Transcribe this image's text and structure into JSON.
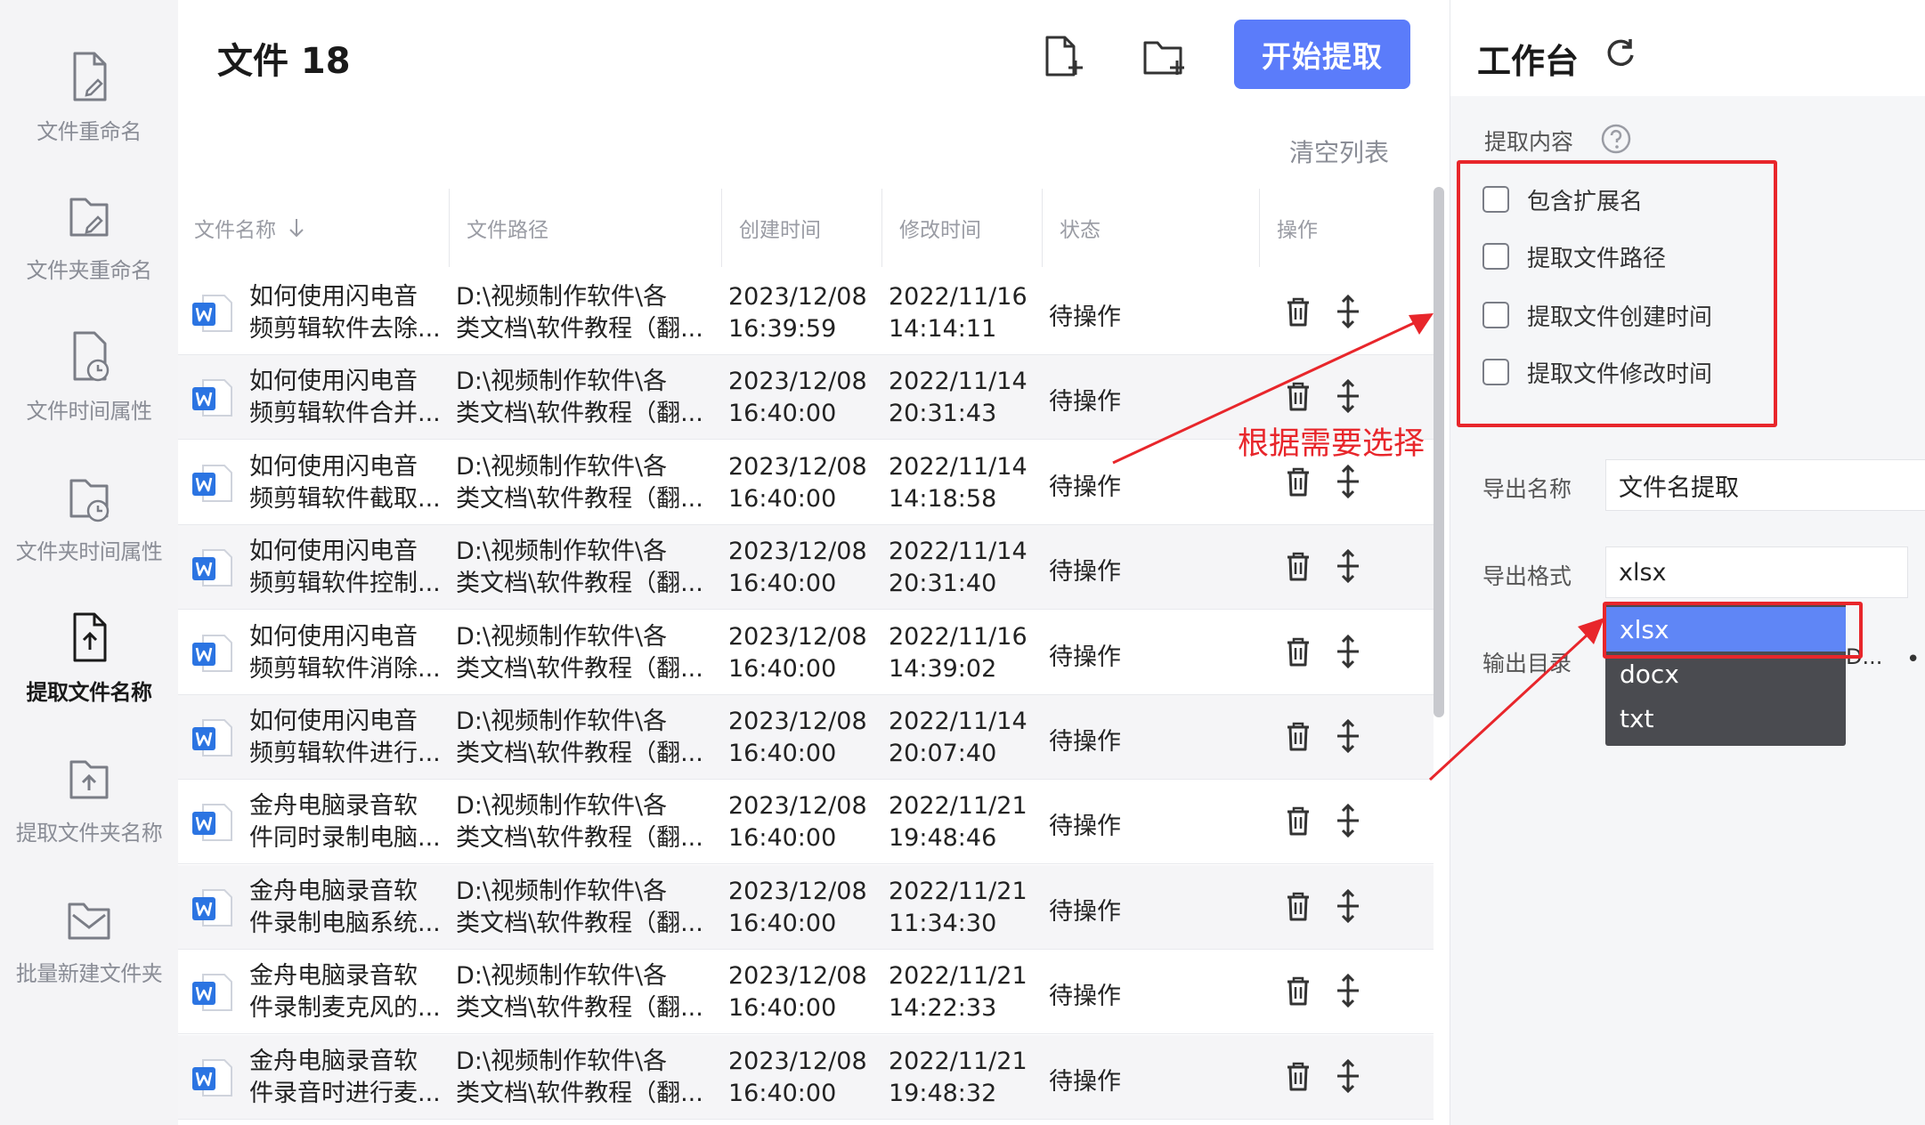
{
  "sidebar": {
    "items": [
      {
        "label": "文件重命名",
        "icon": "file-edit-icon",
        "active": false
      },
      {
        "label": "文件夹重命名",
        "icon": "folder-edit-icon",
        "active": false
      },
      {
        "label": "文件时间属性",
        "icon": "file-clock-icon",
        "active": false
      },
      {
        "label": "文件夹时间属性",
        "icon": "folder-clock-icon",
        "active": false
      },
      {
        "label": "提取文件名称",
        "icon": "file-upload-icon",
        "active": true
      },
      {
        "label": "提取文件夹名称",
        "icon": "folder-upload-icon",
        "active": false
      },
      {
        "label": "批量新建文件夹",
        "icon": "folder-mail-icon",
        "active": false
      }
    ]
  },
  "main": {
    "file_count": "文件 18",
    "start_label": "开始提取",
    "clear_label": "清空列表",
    "add_file_icon": "add-file-icon",
    "add_folder_icon": "add-folder-icon"
  },
  "table": {
    "headers": [
      "文件名称",
      "文件路径",
      "创建时间",
      "修改时间",
      "状态",
      "操作"
    ],
    "sort_icon": "arrow-down-icon",
    "rows": [
      {
        "name": [
          "如何使用闪电音",
          "频剪辑软件去除..."
        ],
        "path": [
          "D:\\视频制作软件\\各",
          "类文档\\软件教程（翻..."
        ],
        "created": [
          "2023/12/08",
          "16:39:59"
        ],
        "modified": [
          "2022/11/16",
          "14:14:11"
        ],
        "status": "待操作"
      },
      {
        "name": [
          "如何使用闪电音",
          "频剪辑软件合并..."
        ],
        "path": [
          "D:\\视频制作软件\\各",
          "类文档\\软件教程（翻..."
        ],
        "created": [
          "2023/12/08",
          "16:40:00"
        ],
        "modified": [
          "2022/11/14",
          "20:31:43"
        ],
        "status": "待操作"
      },
      {
        "name": [
          "如何使用闪电音",
          "频剪辑软件截取..."
        ],
        "path": [
          "D:\\视频制作软件\\各",
          "类文档\\软件教程（翻..."
        ],
        "created": [
          "2023/12/08",
          "16:40:00"
        ],
        "modified": [
          "2022/11/14",
          "14:18:58"
        ],
        "status": "待操作"
      },
      {
        "name": [
          "如何使用闪电音",
          "频剪辑软件控制..."
        ],
        "path": [
          "D:\\视频制作软件\\各",
          "类文档\\软件教程（翻..."
        ],
        "created": [
          "2023/12/08",
          "16:40:00"
        ],
        "modified": [
          "2022/11/14",
          "20:31:40"
        ],
        "status": "待操作"
      },
      {
        "name": [
          "如何使用闪电音",
          "频剪辑软件消除..."
        ],
        "path": [
          "D:\\视频制作软件\\各",
          "类文档\\软件教程（翻..."
        ],
        "created": [
          "2023/12/08",
          "16:40:00"
        ],
        "modified": [
          "2022/11/16",
          "14:39:02"
        ],
        "status": "待操作"
      },
      {
        "name": [
          "如何使用闪电音",
          "频剪辑软件进行..."
        ],
        "path": [
          "D:\\视频制作软件\\各",
          "类文档\\软件教程（翻..."
        ],
        "created": [
          "2023/12/08",
          "16:40:00"
        ],
        "modified": [
          "2022/11/14",
          "20:07:40"
        ],
        "status": "待操作"
      },
      {
        "name": [
          "金舟电脑录音软",
          "件同时录制电脑..."
        ],
        "path": [
          "D:\\视频制作软件\\各",
          "类文档\\软件教程（翻..."
        ],
        "created": [
          "2023/12/08",
          "16:40:00"
        ],
        "modified": [
          "2022/11/21",
          "19:48:46"
        ],
        "status": "待操作"
      },
      {
        "name": [
          "金舟电脑录音软",
          "件录制电脑系统..."
        ],
        "path": [
          "D:\\视频制作软件\\各",
          "类文档\\软件教程（翻..."
        ],
        "created": [
          "2023/12/08",
          "16:40:00"
        ],
        "modified": [
          "2022/11/21",
          "11:34:30"
        ],
        "status": "待操作"
      },
      {
        "name": [
          "金舟电脑录音软",
          "件录制麦克风的..."
        ],
        "path": [
          "D:\\视频制作软件\\各",
          "类文档\\软件教程（翻..."
        ],
        "created": [
          "2023/12/08",
          "16:40:00"
        ],
        "modified": [
          "2022/11/21",
          "14:22:33"
        ],
        "status": "待操作"
      },
      {
        "name": [
          "金舟电脑录音软",
          "件录音时进行麦..."
        ],
        "path": [
          "D:\\视频制作软件\\各",
          "类文档\\软件教程（翻..."
        ],
        "created": [
          "2023/12/08",
          "16:40:00"
        ],
        "modified": [
          "2022/11/21",
          "19:48:32"
        ],
        "status": "待操作"
      }
    ],
    "row_icon": "word-doc-icon",
    "delete_icon": "trash-icon",
    "move_icon": "move-icon"
  },
  "workbench": {
    "title": "工作台",
    "refresh_icon": "refresh-icon",
    "extract_label": "提取内容",
    "help_icon": "help-icon",
    "options": [
      {
        "label": "包含扩展名",
        "checked": false
      },
      {
        "label": "提取文件路径",
        "checked": false
      },
      {
        "label": "提取文件创建时间",
        "checked": false
      },
      {
        "label": "提取文件修改时间",
        "checked": false
      }
    ],
    "export_name_label": "导出名称",
    "export_name_value": "文件名提取",
    "export_format_label": "导出格式",
    "export_format_value": "xlsx",
    "output_dir_label": "输出目录",
    "output_dir_value": "D...",
    "format_options": [
      "xlsx",
      "docx",
      "txt"
    ]
  },
  "annotation": {
    "text": "根据需要选择",
    "color": "#e8262b"
  },
  "colors": {
    "accent": "#5b7cfa",
    "dropdown_bg": "#4a4b50",
    "dropdown_selected": "#5f86f6"
  }
}
